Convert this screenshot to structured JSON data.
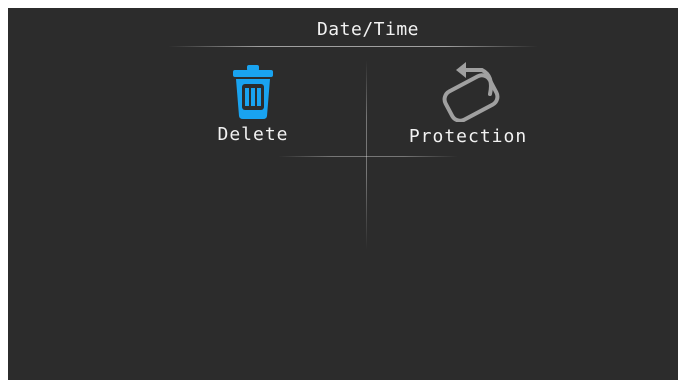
{
  "header": {
    "title": "Date/Time"
  },
  "menu": {
    "items": [
      {
        "label": "Delete",
        "icon": "trash-icon",
        "color": "#19a3f0"
      },
      {
        "label": "Protection",
        "icon": "protect-icon",
        "color": "#a0a0a0"
      }
    ]
  }
}
